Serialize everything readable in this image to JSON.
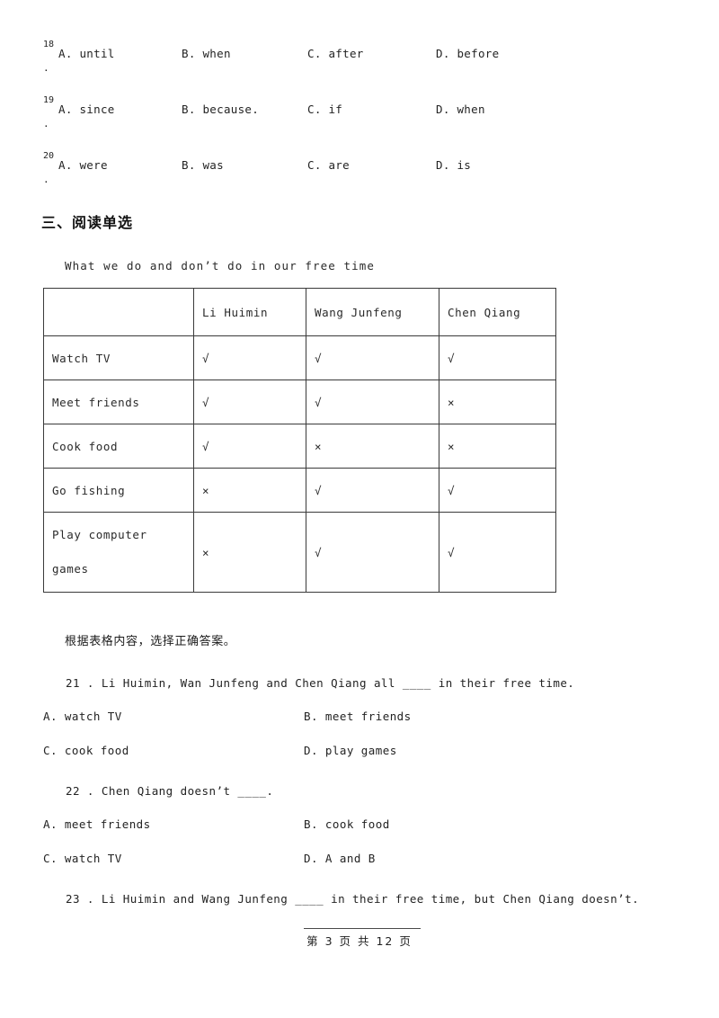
{
  "cloze": {
    "questions": [
      {
        "number": "18",
        "dot": ".",
        "options": [
          "A. until",
          "B. when",
          "C. after",
          "D. before"
        ]
      },
      {
        "number": "19",
        "dot": ".",
        "options": [
          "A. since",
          "B. because.",
          "C. if",
          "D. when"
        ]
      },
      {
        "number": "20",
        "dot": ".",
        "options": [
          "A. were",
          "B. was",
          "C. are",
          "D. is"
        ]
      }
    ]
  },
  "section": {
    "heading": "三、阅读单选"
  },
  "passage": {
    "title": "What we do and don’t do in our free time",
    "table": {
      "headers": [
        "",
        "Li Huimin",
        "Wang Junfeng",
        "Chen Qiang"
      ],
      "rows": [
        {
          "activity": "Watch TV",
          "marks": [
            "√",
            "√",
            "√"
          ]
        },
        {
          "activity": "Meet friends",
          "marks": [
            "√",
            "√",
            "×"
          ]
        },
        {
          "activity": "Cook food",
          "marks": [
            "√",
            "×",
            "×"
          ]
        },
        {
          "activity": "Go fishing",
          "marks": [
            "×",
            "√",
            "√"
          ]
        },
        {
          "activity_line1": "Play computer",
          "activity_line2": "games",
          "marks": [
            "×",
            "√",
            "√"
          ]
        }
      ]
    },
    "instruction": "根据表格内容，选择正确答案。"
  },
  "reading_questions": [
    {
      "stem": "21 . Li Huimin, Wan Junfeng and Chen Qiang all ____ in their free time.",
      "options": [
        "A. watch TV",
        "B. meet friends",
        "C. cook food",
        "D. play games"
      ]
    },
    {
      "stem": "22 . Chen Qiang doesn’t ____.",
      "options": [
        "A. meet friends",
        "B. cook food",
        "C. watch TV",
        "D. A and B"
      ]
    },
    {
      "stem": "23 . Li Huimin and Wang Junfeng ____ in their free time, but Chen Qiang doesn’t.",
      "options": []
    }
  ],
  "footer": {
    "text": "第 3 页 共 12 页"
  }
}
